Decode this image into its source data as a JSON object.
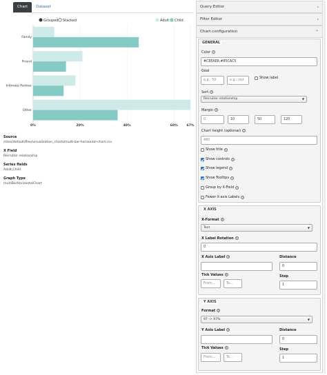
{
  "tabs": [
    {
      "label": "Chart",
      "active": true
    },
    {
      "label": "Dataset",
      "active": false
    }
  ],
  "chart": {
    "controls": {
      "grouped": "Grouped",
      "stacked": "Stacked",
      "selected": "Grouped"
    }
  },
  "chart_data": {
    "type": "bar",
    "orientation": "horizontal",
    "categories": [
      "Family",
      "Friend",
      "Intimate Partner",
      "Other"
    ],
    "series": [
      {
        "name": "Adult",
        "color": "#CEEAE8",
        "values": [
          9,
          21,
          18,
          67
        ]
      },
      {
        "name": "Child",
        "color": "#85CAC5",
        "values": [
          45,
          14,
          13,
          36
        ]
      }
    ],
    "x_tick_labels": [
      "0%",
      "20%",
      "40%",
      "60%",
      "67%"
    ],
    "x_ticks": [
      0,
      20,
      40,
      60,
      67
    ],
    "xlim": [
      0,
      67
    ],
    "grid": true,
    "legend_position": "top-right"
  },
  "info": {
    "source_label": "Source",
    "source_value": "/sites/default/files/visualization_charts/multi-bar-horizontal-chart.csv",
    "xfield_label": "X Field",
    "xfield_value": "Recruiter relationship",
    "series_label": "Series fields",
    "series_value": "Adult,Child",
    "graphtype_label": "Graph Type",
    "graphtype_value": "multiBarHorizontalChart"
  },
  "panels": {
    "query_editor": "Query Editor",
    "filter_editor": "Filter Editor",
    "chart_configuration": "Chart configuration"
  },
  "general": {
    "legend": "GENERAL",
    "color_label": "Color",
    "color_value": "#CEEAE8,#85CAC5",
    "goal_label": "Goal",
    "goal_value_placeholder": "e.g.: 50",
    "goal_color_placeholder": "e.g.: red",
    "show_label": "Show label",
    "sort_label": "Sort",
    "sort_value": "Recruiter relationship",
    "margin_label": "Margin",
    "margin_values": [
      "0",
      "10",
      "50",
      "120"
    ],
    "chart_height_label": "Chart height (optional)",
    "chart_height_value": "480",
    "options": [
      {
        "label": "Show title",
        "checked": false
      },
      {
        "label": "Show controls",
        "checked": true
      },
      {
        "label": "Show legend",
        "checked": true
      },
      {
        "label": "Show Tooltips",
        "checked": true
      },
      {
        "label": "Group by X-Field",
        "checked": false
      },
      {
        "label": "Fewer X-axis Labels",
        "checked": false
      }
    ]
  },
  "xaxis": {
    "legend": "X AXIS",
    "format_label": "X-Format",
    "format_value": "Text",
    "rotation_label": "X Label Rotation",
    "rotation_value": "0",
    "axis_label_label": "X Axis Label",
    "axis_label_value": "",
    "distance_label": "Distance",
    "distance_value": "0",
    "tick_values_label": "Tick Values",
    "from_placeholder": "From...",
    "to_placeholder": "To...",
    "step_label": "Step",
    "step_value": "1"
  },
  "yaxis": {
    "legend": "Y AXIS",
    "format_label": "Format",
    "format_value": "97 -> 97%",
    "axis_label_label": "Y Axis Label",
    "axis_label_value": "",
    "distance_label": "Distance",
    "distance_value": "0",
    "tick_values_label": "Tick Values",
    "from_placeholder": "From...",
    "to_placeholder": "To...",
    "step_label": "Step",
    "step_value": "1"
  }
}
